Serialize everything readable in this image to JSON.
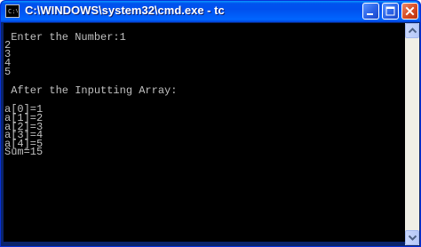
{
  "window": {
    "title": "C:\\WINDOWS\\system32\\cmd.exe - tc",
    "app_icon": "cmd-prompt-icon",
    "controls": [
      "minimize-icon",
      "maximize-icon",
      "close-icon"
    ]
  },
  "console": {
    "lines": [
      "",
      " Enter the Number:1",
      "2",
      "3",
      "4",
      "5",
      "",
      "",
      " After the Inputting Array:",
      "",
      "",
      "a[0]=1",
      "a[1]=2",
      "a[2]=3",
      "a[3]=4",
      "a[4]=5",
      "Sum=15"
    ],
    "text_color": "#c0c0c0",
    "background": "#000000"
  },
  "scrollbar": {
    "up": "scroll-up-arrow-icon",
    "down": "scroll-down-arrow-icon"
  }
}
